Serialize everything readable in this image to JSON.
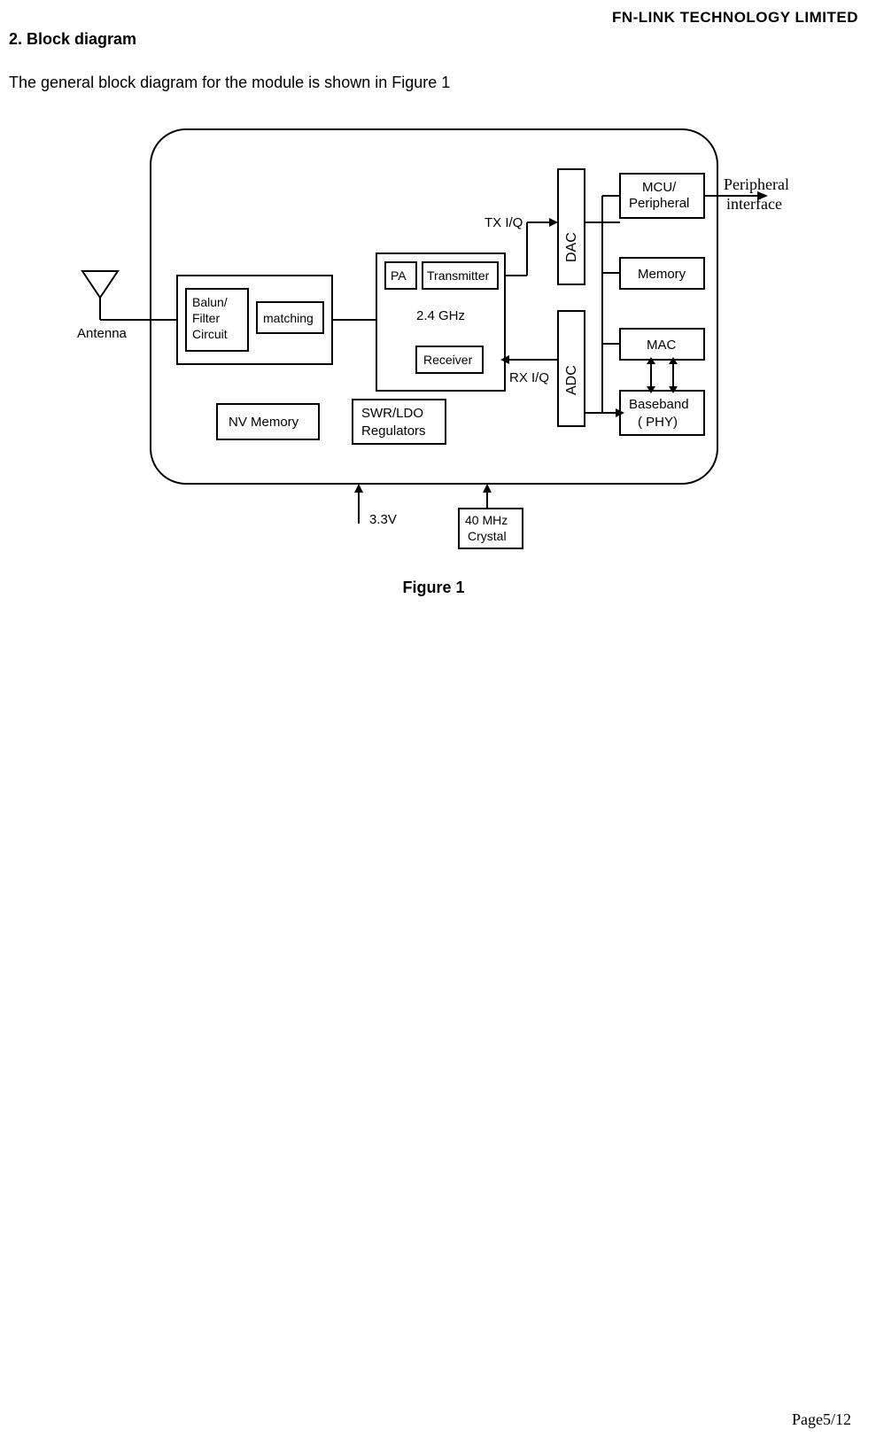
{
  "header": {
    "company": "FN-LINK  TECHNOLOGY  LIMITED"
  },
  "section": {
    "title": "2. Block diagram",
    "intro": "The general block diagram for the module is shown in Figure 1",
    "figure_caption": "Figure 1"
  },
  "footer": {
    "page": "Page5/12"
  },
  "diagram": {
    "antenna_label": "Antenna",
    "peripheral_interface_top": "Peripheral",
    "peripheral_interface_bot": "interface",
    "balun": "Balun/\nFilter\nCircuit",
    "matching": "matching",
    "nv_memory": "NV Memory",
    "pa": "PA",
    "transmitter": "Transmitter",
    "receiver": "Receiver",
    "radio_freq": "2.4 GHz",
    "swr": "SWR/LDO\nRegulators",
    "dac": "DAC",
    "adc": "ADC",
    "mcu": "MCU/\nPeripheral",
    "memory": "Memory",
    "mac": "MAC",
    "baseband": "Baseband\n( PHY)",
    "tx_iq": "TX I/Q",
    "rx_iq": "RX I/Q",
    "v33": "3.3V",
    "crystal": "40 MHz\nCrystal"
  }
}
